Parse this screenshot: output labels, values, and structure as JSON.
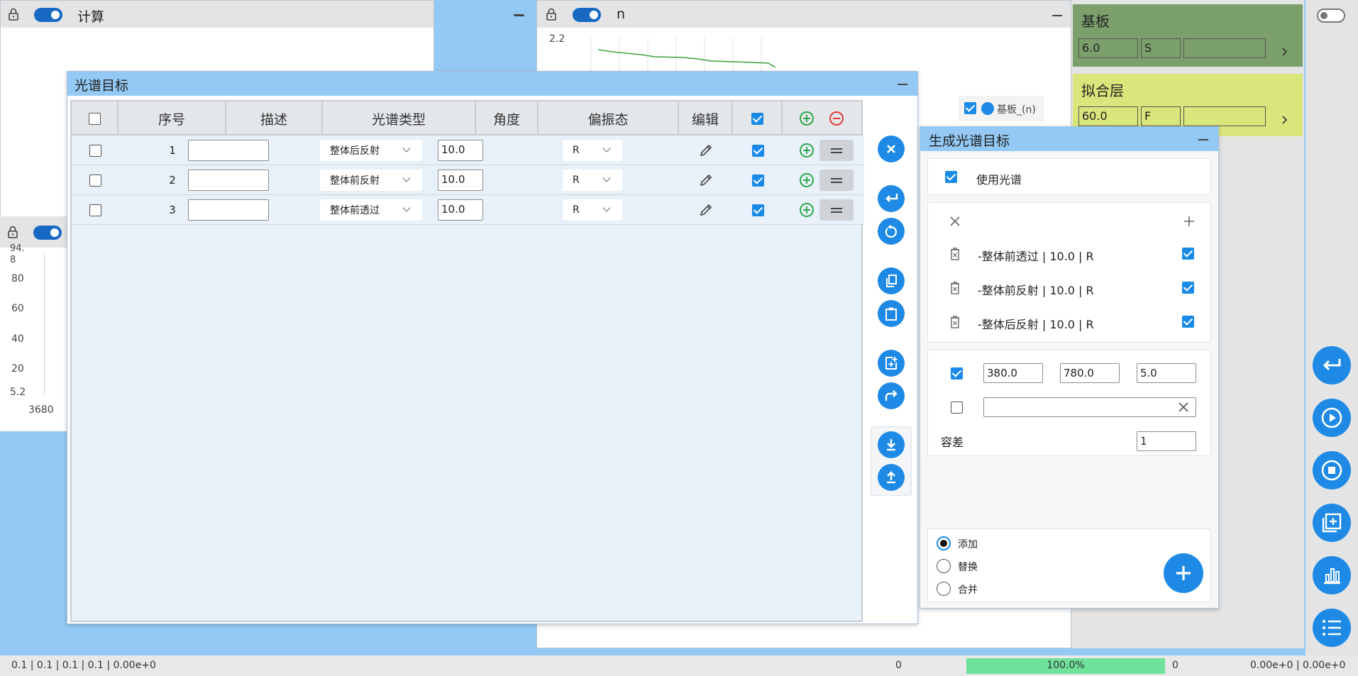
{
  "calc_panel": {
    "title": "计算"
  },
  "n_panel": {
    "title": "n",
    "ytick_top": "2.2",
    "legend": "基板_(n)"
  },
  "bottom_left_chart": {
    "yticks": [
      "94.\n8",
      "80",
      "60",
      "40",
      "20",
      "5.2"
    ],
    "xtick": "3680"
  },
  "substrate": {
    "title": "基板",
    "thickness": "6.0",
    "code": "S",
    "extra": "",
    "bg": "#7ca06c"
  },
  "fit_layer": {
    "title": "拟合层",
    "thickness": "60.0",
    "code": "F",
    "extra": "",
    "bg": "#d9e67b"
  },
  "spectrum_dialog": {
    "title": "光谱目标",
    "columns": [
      "序号",
      "描述",
      "光谱类型",
      "角度",
      "偏振态",
      "编辑"
    ],
    "rows": [
      {
        "index": "1",
        "desc": "",
        "type": "整体后反射",
        "angle": "10.0",
        "pol": "R",
        "checked": true
      },
      {
        "index": "2",
        "desc": "",
        "type": "整体前反射",
        "angle": "10.0",
        "pol": "R",
        "checked": true
      },
      {
        "index": "3",
        "desc": "",
        "type": "整体前透过",
        "angle": "10.0",
        "pol": "R",
        "checked": true
      }
    ]
  },
  "generate_dialog": {
    "title": "生成光谱目标",
    "use_spectrum": "使用光谱",
    "items": [
      "-整体前透过 | 10.0 | R",
      "-整体前反射 | 10.0 | R",
      "-整体后反射 | 10.0 | R"
    ],
    "range_start": "380.0",
    "range_end": "780.0",
    "range_step": "5.0",
    "custom_value": "",
    "tolerance_label": "容差",
    "tolerance_value": "1",
    "modes": [
      "添加",
      "替换",
      "合并"
    ]
  },
  "status_bar": {
    "left": "0.1 | 0.1 | 0.1 | 0.1 | 0.00e+0",
    "mid_count": "0",
    "progress_label": "100.0%",
    "progress_value": 100,
    "right_count": "0",
    "right": "0.00e+0 | 0.00e+0",
    "progress_color": "#6ee19a"
  },
  "colors": {
    "accent": "#1e8ae6",
    "dialog_title": "#93c9f4",
    "plus": "#2ea84a",
    "minus": "#e23b3b"
  }
}
